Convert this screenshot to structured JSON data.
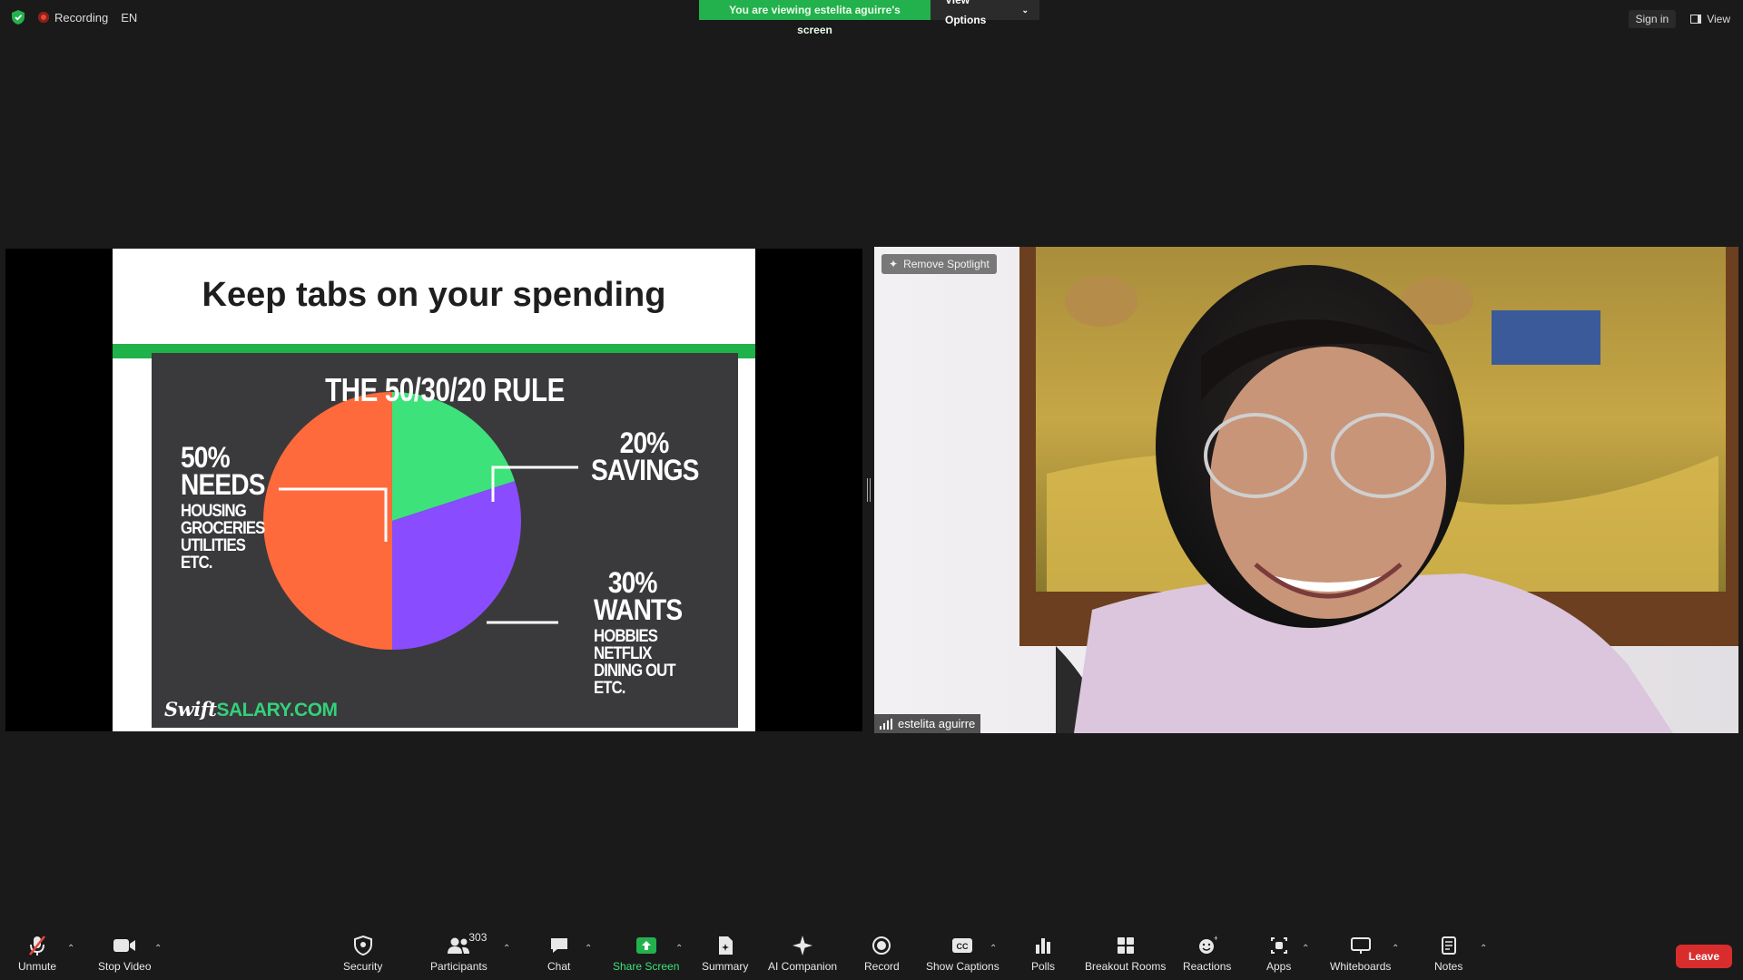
{
  "top_bar": {
    "recording_label": "Recording",
    "language": "EN",
    "viewing_banner": "You are viewing estelita aguirre's screen",
    "view_options_label": "View Options",
    "sign_in_label": "Sign in",
    "view_label": "View"
  },
  "shared_slide": {
    "title": "Keep tabs on your spending",
    "rule_title": "THE 50/30/20 RULE",
    "brand_prefix": "Swift",
    "brand_suffix": "SALARY.COM",
    "needs": {
      "pct": "50%",
      "name": "NEEDS",
      "items": [
        "HOUSING",
        "GROCERIES",
        "UTILITIES",
        "ETC."
      ]
    },
    "savings": {
      "pct": "20%",
      "name": "SAVINGS"
    },
    "wants": {
      "pct": "30%",
      "name": "WANTS",
      "items": [
        "HOBBIES",
        "NETFLIX",
        "DINING OUT",
        "ETC."
      ]
    }
  },
  "chart_data": {
    "type": "pie",
    "title": "THE 50/30/20 RULE",
    "categories": [
      "NEEDS",
      "SAVINGS",
      "WANTS"
    ],
    "values": [
      50,
      20,
      30
    ],
    "colors": [
      "#ff6a3d",
      "#3ee27a",
      "#8a4cff"
    ]
  },
  "video": {
    "spotlight_label": "Remove Spotlight",
    "participant_name": "estelita aguirre"
  },
  "toolbar": {
    "unmute": "Unmute",
    "stop_video": "Stop Video",
    "security": "Security",
    "participants": "Participants",
    "participants_count": "303",
    "chat": "Chat",
    "share_screen": "Share Screen",
    "summary": "Summary",
    "ai_companion": "AI Companion",
    "record": "Record",
    "show_captions": "Show Captions",
    "polls": "Polls",
    "breakout_rooms": "Breakout Rooms",
    "reactions": "Reactions",
    "apps": "Apps",
    "whiteboards": "Whiteboards",
    "notes": "Notes",
    "leave": "Leave"
  }
}
